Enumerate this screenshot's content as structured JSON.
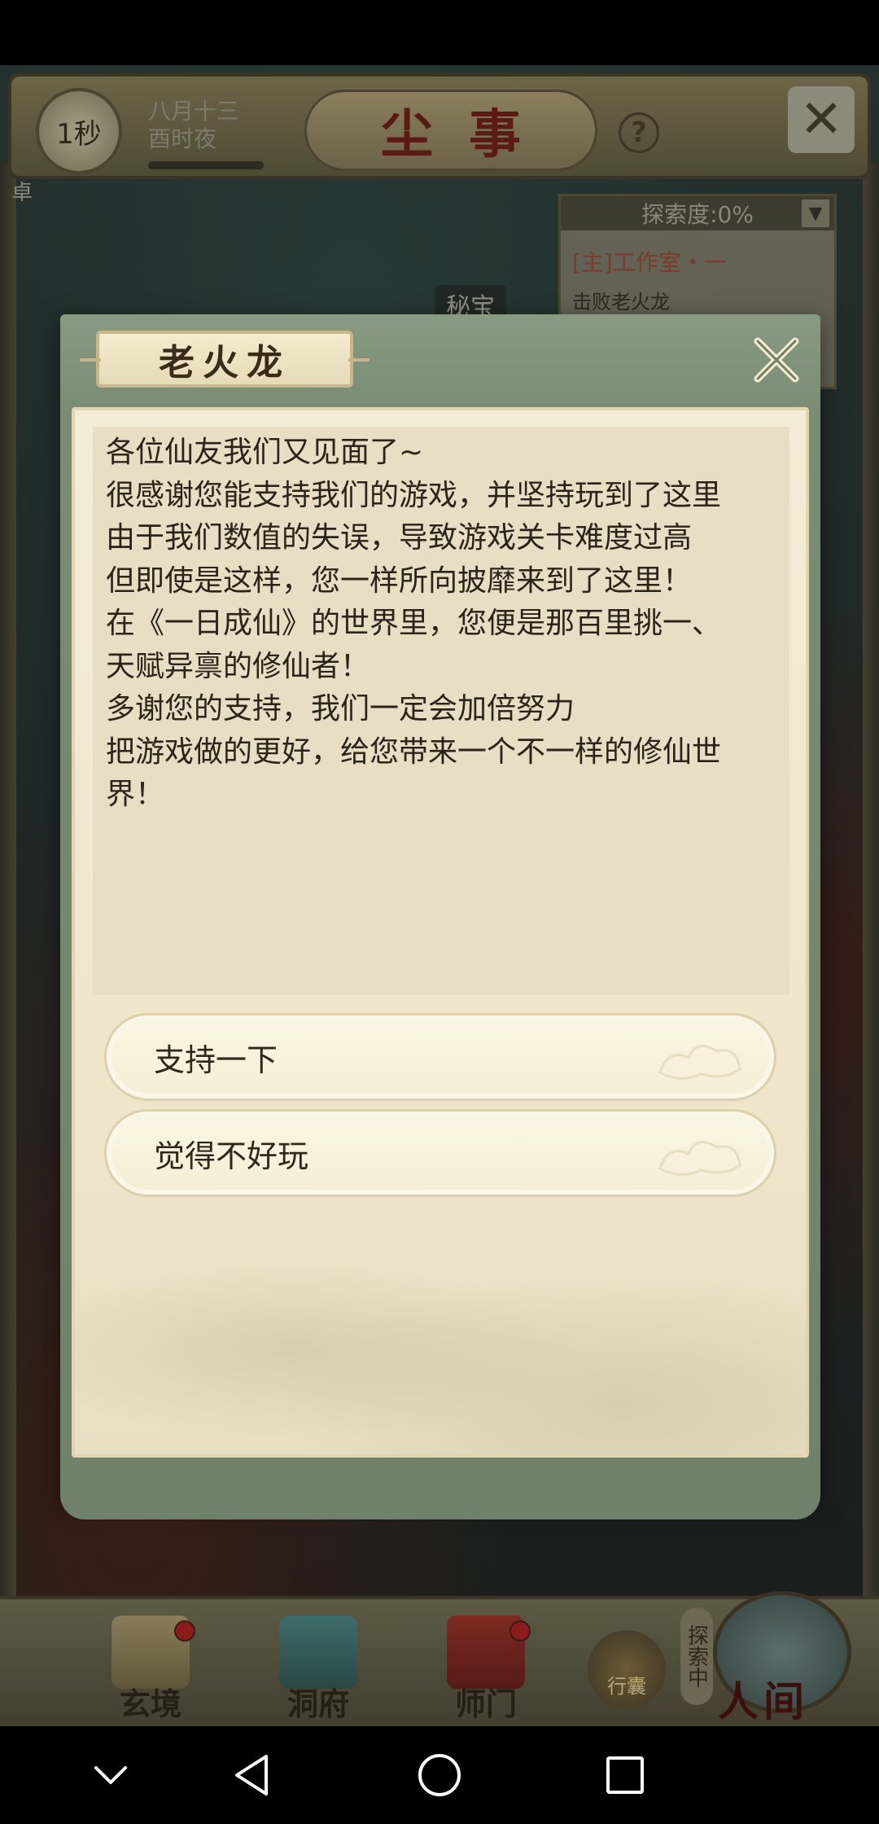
{
  "game_bg": {
    "timer_label": "1秒",
    "date_line1": "八月十三",
    "date_line2": "酉时夜",
    "title": "尘事",
    "help_symbol": "?",
    "left_tag": "卓",
    "explore": {
      "header": "探索度:0%",
      "quest_title": "[主]工作室・一",
      "quest_desc": "击败老火龙"
    },
    "secret_label": "秘宝",
    "nav": [
      {
        "label": "玄境",
        "has_dot": true
      },
      {
        "label": "洞府",
        "has_dot": false
      },
      {
        "label": "师门",
        "has_dot": true
      }
    ],
    "bag_label": "行囊",
    "world_tag": "探索中",
    "world_label": "人间"
  },
  "dialog": {
    "title": "老火龙",
    "message_lines": [
      "各位仙友我们又见面了~",
      "很感谢您能支持我们的游戏，并坚持玩到了这里",
      "由于我们数值的失误，导致游戏关卡难度过高",
      "但即使是这样，您一样所向披靡来到了这里！",
      "在《一日成仙》的世界里，您便是那百里挑一、",
      "天赋异禀的修仙者！",
      "多谢您的支持，我们一定会加倍努力",
      "把游戏做的更好，给您带来一个不一样的修仙世",
      "界！"
    ],
    "options": [
      "支持一下",
      "觉得不好玩"
    ]
  },
  "colors": {
    "dialog_frame": "#7b8c75",
    "paper": "#efe6cc",
    "title_text": "#3a2a17",
    "accent_red": "#8a1d1a"
  },
  "icons": {
    "close": "close-x-icon",
    "back": "triangle-back-icon",
    "home": "circle-home-icon",
    "recents": "square-recents-icon",
    "collapse": "chevron-down-icon"
  }
}
